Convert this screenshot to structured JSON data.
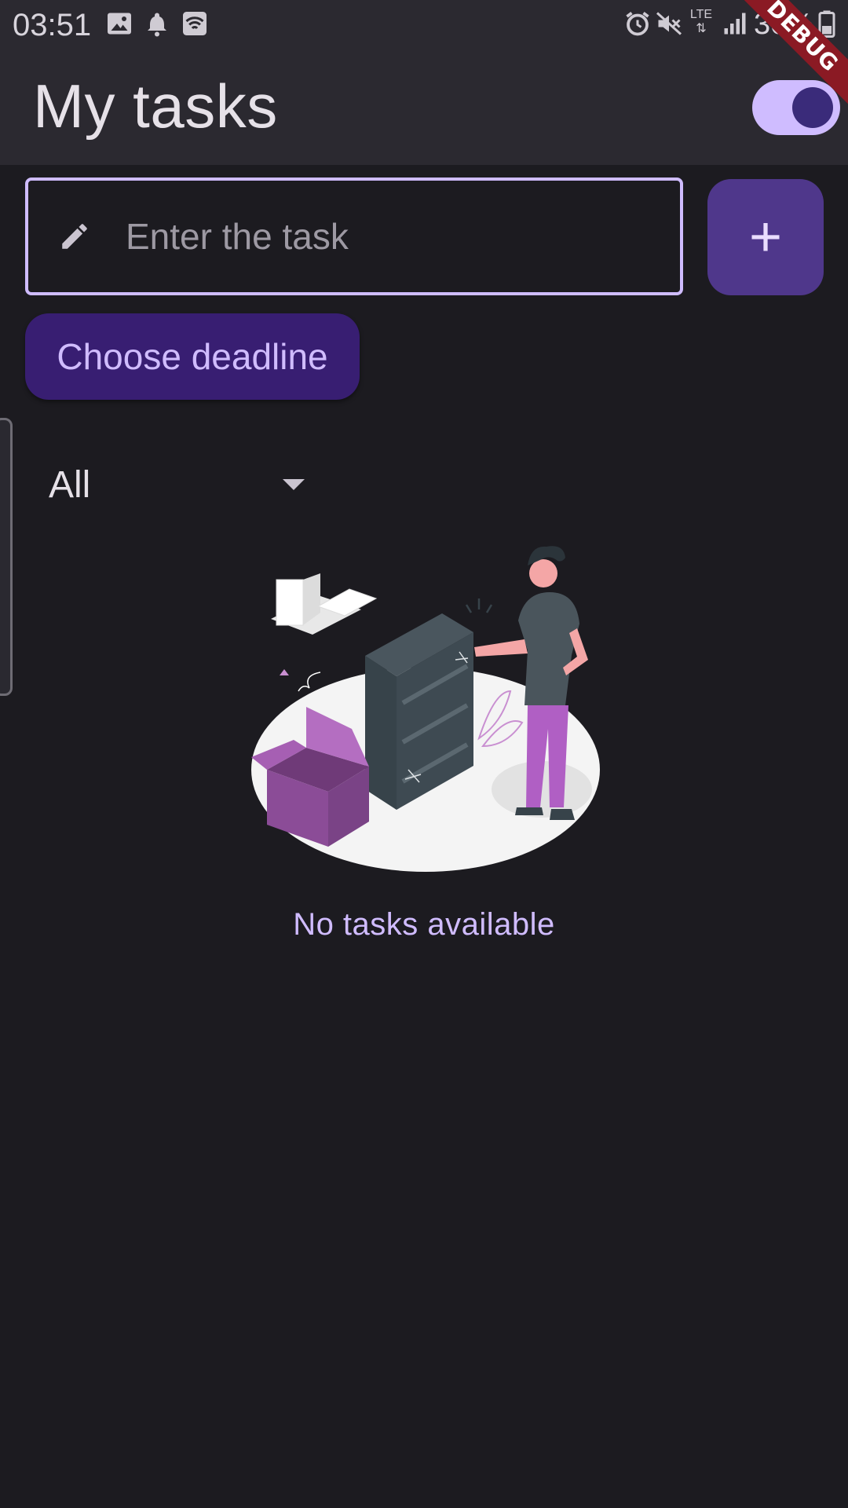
{
  "status_bar": {
    "time": "03:51",
    "battery": "30%",
    "network": "LTE",
    "icons": [
      "image-icon",
      "bell-icon",
      "wifi-icon",
      "alarm-icon",
      "mute-icon",
      "lte-icon",
      "signal-icon",
      "battery-icon"
    ]
  },
  "app_bar": {
    "title": "My tasks",
    "theme_toggle_on": true
  },
  "debug_banner": "DEBUG",
  "task_input": {
    "placeholder": "Enter the task",
    "value": ""
  },
  "buttons": {
    "add_label": "+",
    "deadline_label": "Choose deadline"
  },
  "filter": {
    "selected": "All"
  },
  "empty_state": {
    "message": "No tasks available"
  },
  "colors": {
    "background": "#1c1b20",
    "app_bar": "#2b2930",
    "primary": "#cfbcff",
    "add_button": "#4f378b",
    "deadline_button": "#381e72",
    "accent_text": "#d0bcff",
    "debug": "#8b1a24"
  }
}
